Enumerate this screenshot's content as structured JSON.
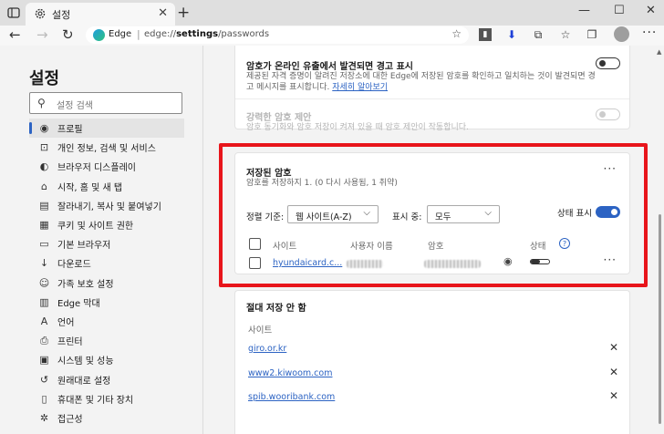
{
  "tab": {
    "title": "설정",
    "close": "✕"
  },
  "new_tab": "+",
  "window": {
    "minimize": "—",
    "maximize": "☐",
    "close": "✕"
  },
  "address": {
    "brand": "Edge",
    "separator": "|",
    "url_prefix": "edge://",
    "url_bold": "settings",
    "url_rest": "/passwords"
  },
  "sidebar": {
    "title": "설정",
    "search_placeholder": "설정 검색",
    "items": [
      {
        "label": "프로필",
        "icon": "profile-icon",
        "active": true
      },
      {
        "label": "개인 정보, 검색 및 서비스",
        "icon": "lock-icon"
      },
      {
        "label": "브라우저 디스플레이",
        "icon": "palette-icon"
      },
      {
        "label": "시작, 홈 및 새 탭",
        "icon": "home-icon"
      },
      {
        "label": "잘라내기, 복사 및 붙여넣기",
        "icon": "clipboard-icon"
      },
      {
        "label": "쿠키 및 사이트 권한",
        "icon": "cookie-icon"
      },
      {
        "label": "기본 브라우저",
        "icon": "browser-icon"
      },
      {
        "label": "다운로드",
        "icon": "download-icon"
      },
      {
        "label": "가족 보호 설정",
        "icon": "family-icon"
      },
      {
        "label": "Edge 막대",
        "icon": "edge-bar-icon"
      },
      {
        "label": "언어",
        "icon": "language-icon"
      },
      {
        "label": "프린터",
        "icon": "printer-icon"
      },
      {
        "label": "시스템 및 성능",
        "icon": "system-icon"
      },
      {
        "label": "원래대로 설정",
        "icon": "reset-icon"
      },
      {
        "label": "휴대폰 및 기타 장치",
        "icon": "phone-icon"
      },
      {
        "label": "접근성",
        "icon": "accessibility-icon"
      }
    ]
  },
  "leak_alert": {
    "title": "암호가 온라인 유출에서 발견되면 경고 표시",
    "desc": "제공된 자격 증명이 알려진 저장소에 대한 Edge에 저장된 암호를 확인하고 일치하는 것이 발견되면 경고 메시지를 표시합니다.",
    "learn_more": "자세히 알아보기",
    "enabled": false
  },
  "strong_password": {
    "title": "강력한 암호 제안",
    "desc": "암호 동기화와 암호 저장이 켜져 있을 때 암호 제안이 작동합니다.",
    "enabled": false
  },
  "saved": {
    "title": "저장된 암호",
    "subtitle": "암호를 저장하지 1. (0 다시 사용됨, 1 취약)",
    "more": "···",
    "sort_label": "정렬 기준:",
    "sort_value": "웹 사이트(A-Z)",
    "show_label": "표시 중:",
    "show_value": "모두",
    "status_label": "상태 표시",
    "status_enabled": true,
    "columns": {
      "site": "사이트",
      "user": "사용자 이름",
      "password": "암호",
      "status": "상태",
      "help": "?"
    },
    "rows": [
      {
        "site": "hyundaicard.c..."
      }
    ]
  },
  "never": {
    "title": "절대 저장 안 함",
    "column": "사이트",
    "sites": [
      "giro.or.kr",
      "www2.kiwoom.com",
      "spib.wooribank.com"
    ]
  },
  "colors": {
    "accent": "#2c63c3",
    "highlight": "#e8151b"
  }
}
